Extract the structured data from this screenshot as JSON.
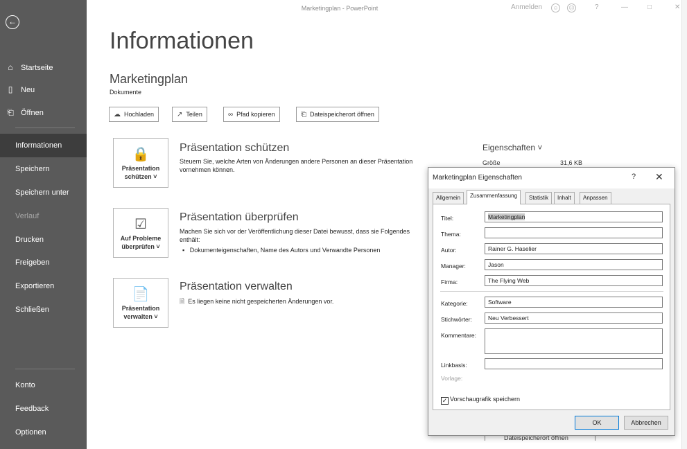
{
  "titlebar": {
    "app_title": "Marketingplan - PowerPoint",
    "signin": "Anmelden",
    "smile": "☺",
    "frown": "☹",
    "help": "?",
    "minimize": "—",
    "maximize": "□",
    "close": "✕"
  },
  "sidebar": {
    "back": "←",
    "top_items": [
      {
        "icon": "⌂",
        "label": "Startseite"
      },
      {
        "icon": "▯",
        "label": "Neu"
      },
      {
        "icon": "⎗",
        "label": "Öffnen"
      }
    ],
    "items": [
      {
        "label": "Informationen"
      },
      {
        "label": "Speichern"
      },
      {
        "label": "Speichern unter"
      },
      {
        "label": "Verlauf"
      },
      {
        "label": "Drucken"
      },
      {
        "label": "Freigeben"
      },
      {
        "label": "Exportieren"
      },
      {
        "label": "Schließen"
      }
    ],
    "bottom_items": [
      {
        "label": "Konto"
      },
      {
        "label": "Feedback"
      },
      {
        "label": "Optionen"
      }
    ]
  },
  "main": {
    "title": "Informationen",
    "doc_name": "Marketingplan",
    "doc_location": "Dokumente",
    "actions": [
      {
        "icon": "☁",
        "label": "Hochladen"
      },
      {
        "icon": "↗",
        "label": "Teilen"
      },
      {
        "icon": "∞",
        "label": "Pfad kopieren"
      },
      {
        "icon": "⎗",
        "label": "Dateispeicherort öffnen"
      }
    ],
    "protect": {
      "tile_line1": "Präsentation",
      "tile_line2": "schützen ˅",
      "title": "Präsentation schützen",
      "text_line1": "Steuern Sie, welche Arten von Änderungen andere Personen an dieser Präsentation",
      "text_line2": "vornehmen können."
    },
    "inspect": {
      "tile_line1": "Auf Probleme",
      "tile_line2": "überprüfen ˅",
      "title": "Präsentation überprüfen",
      "text_line1": "Machen Sie sich vor der Veröffentlichung dieser Datei bewusst, dass sie Folgendes",
      "text_line2": "enthält:",
      "bullet": "Dokumenteigenschaften, Name des Autors und Verwandte Personen"
    },
    "manage": {
      "tile_line1": "Präsentation",
      "tile_line2": "verwalten ˅",
      "title": "Präsentation verwalten",
      "text": "Es liegen keine nicht gespeicherten Änderungen vor."
    },
    "properties": {
      "heading": "Eigenschaften ˅",
      "size_label": "Größe",
      "size_value": "31,6 KB",
      "peek_text": "Dateispeicherort öffnen"
    }
  },
  "dialog": {
    "title": "Marketingplan Eigenschaften",
    "help": "?",
    "close": "✕",
    "tabs": [
      "Allgemein",
      "Zusammenfassung",
      "Statistik",
      "Inhalt",
      "Anpassen"
    ],
    "active_tab": "Zusammenfassung",
    "fields": {
      "titel": {
        "label": "Titel:",
        "value": "Marketingplan"
      },
      "thema": {
        "label": "Thema:",
        "value": ""
      },
      "autor": {
        "label": "Autor:",
        "value": "Rainer G. Haselier"
      },
      "manager": {
        "label": "Manager:",
        "value": "Jason"
      },
      "firma": {
        "label": "Firma:",
        "value": "The Flying Web"
      },
      "kategorie": {
        "label": "Kategorie:",
        "value": "Software"
      },
      "stichwoerter": {
        "label": "Stichwörter:",
        "value": "Neu Verbessert"
      },
      "kommentare": {
        "label": "Kommentare:",
        "value": ""
      },
      "linkbasis": {
        "label": "Linkbasis:",
        "value": ""
      },
      "vorlage": {
        "label": "Vorlage:"
      }
    },
    "preview_check": {
      "label": "Vorschaugrafik speichern",
      "mark": "✓"
    },
    "ok": "OK",
    "cancel": "Abbrechen"
  }
}
